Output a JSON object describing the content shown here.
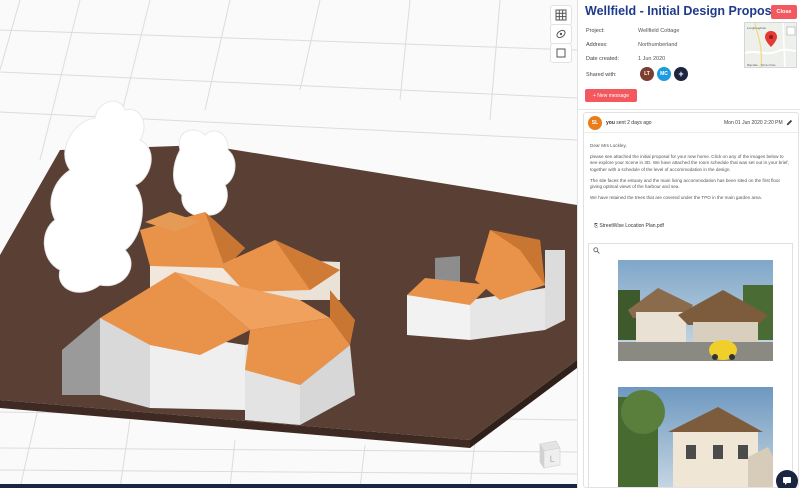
{
  "viewer": {
    "tools": [
      {
        "icon": "grid-icon"
      },
      {
        "icon": "orbit-icon"
      },
      {
        "icon": "frame-icon"
      }
    ],
    "nav_cube_label": "L"
  },
  "panel": {
    "title": "Wellfield - Initial Design Proposal",
    "close_label": "Close",
    "project_label": "Project:",
    "project_value": "Wellfield Cottage",
    "address_label": "Address:",
    "address_value": "Northumberland",
    "date_label": "Date created:",
    "date_value": "1 Jun 2020",
    "shared_label": "Shared with:",
    "shared_avatars": [
      {
        "initials": "LT",
        "color": "#7b3f2f"
      },
      {
        "initials": "MC",
        "color": "#1e9be0"
      }
    ],
    "add_share_label": "+",
    "new_message_label": "+ New message",
    "map_labels": {
      "place": "Longhoughton",
      "footer": "Map data ... Terms of Use"
    }
  },
  "message": {
    "avatar_initials": "SL",
    "sender_name": "you",
    "sent_text": "sent 2 days ago",
    "date": "Mon 01 Jun 2020 2:20 PM",
    "greeting": "Dear Mrs Lockley,",
    "paragraph1": "please see attached the initial proposal for your new home. Click on any of the images below to see explore your Scene in 3D. We have attached the room schedule that was set out in your brief, together with a schedule of the level of accommodation in the design.",
    "paragraph2": "The site faces the estuary and the main living accommodation has been sited on the first floor giving optimal views of the harbour and sea.",
    "paragraph3": "We have retained the trees that are covered under the TPO in the main garden area.",
    "attachment_label": "StreetWise Location Plan.pdf"
  },
  "colors": {
    "accent": "#f2585d",
    "title": "#1f3a8a",
    "ground": "#5a4034",
    "roof": "#e8924a",
    "navy": "#1b2440"
  }
}
